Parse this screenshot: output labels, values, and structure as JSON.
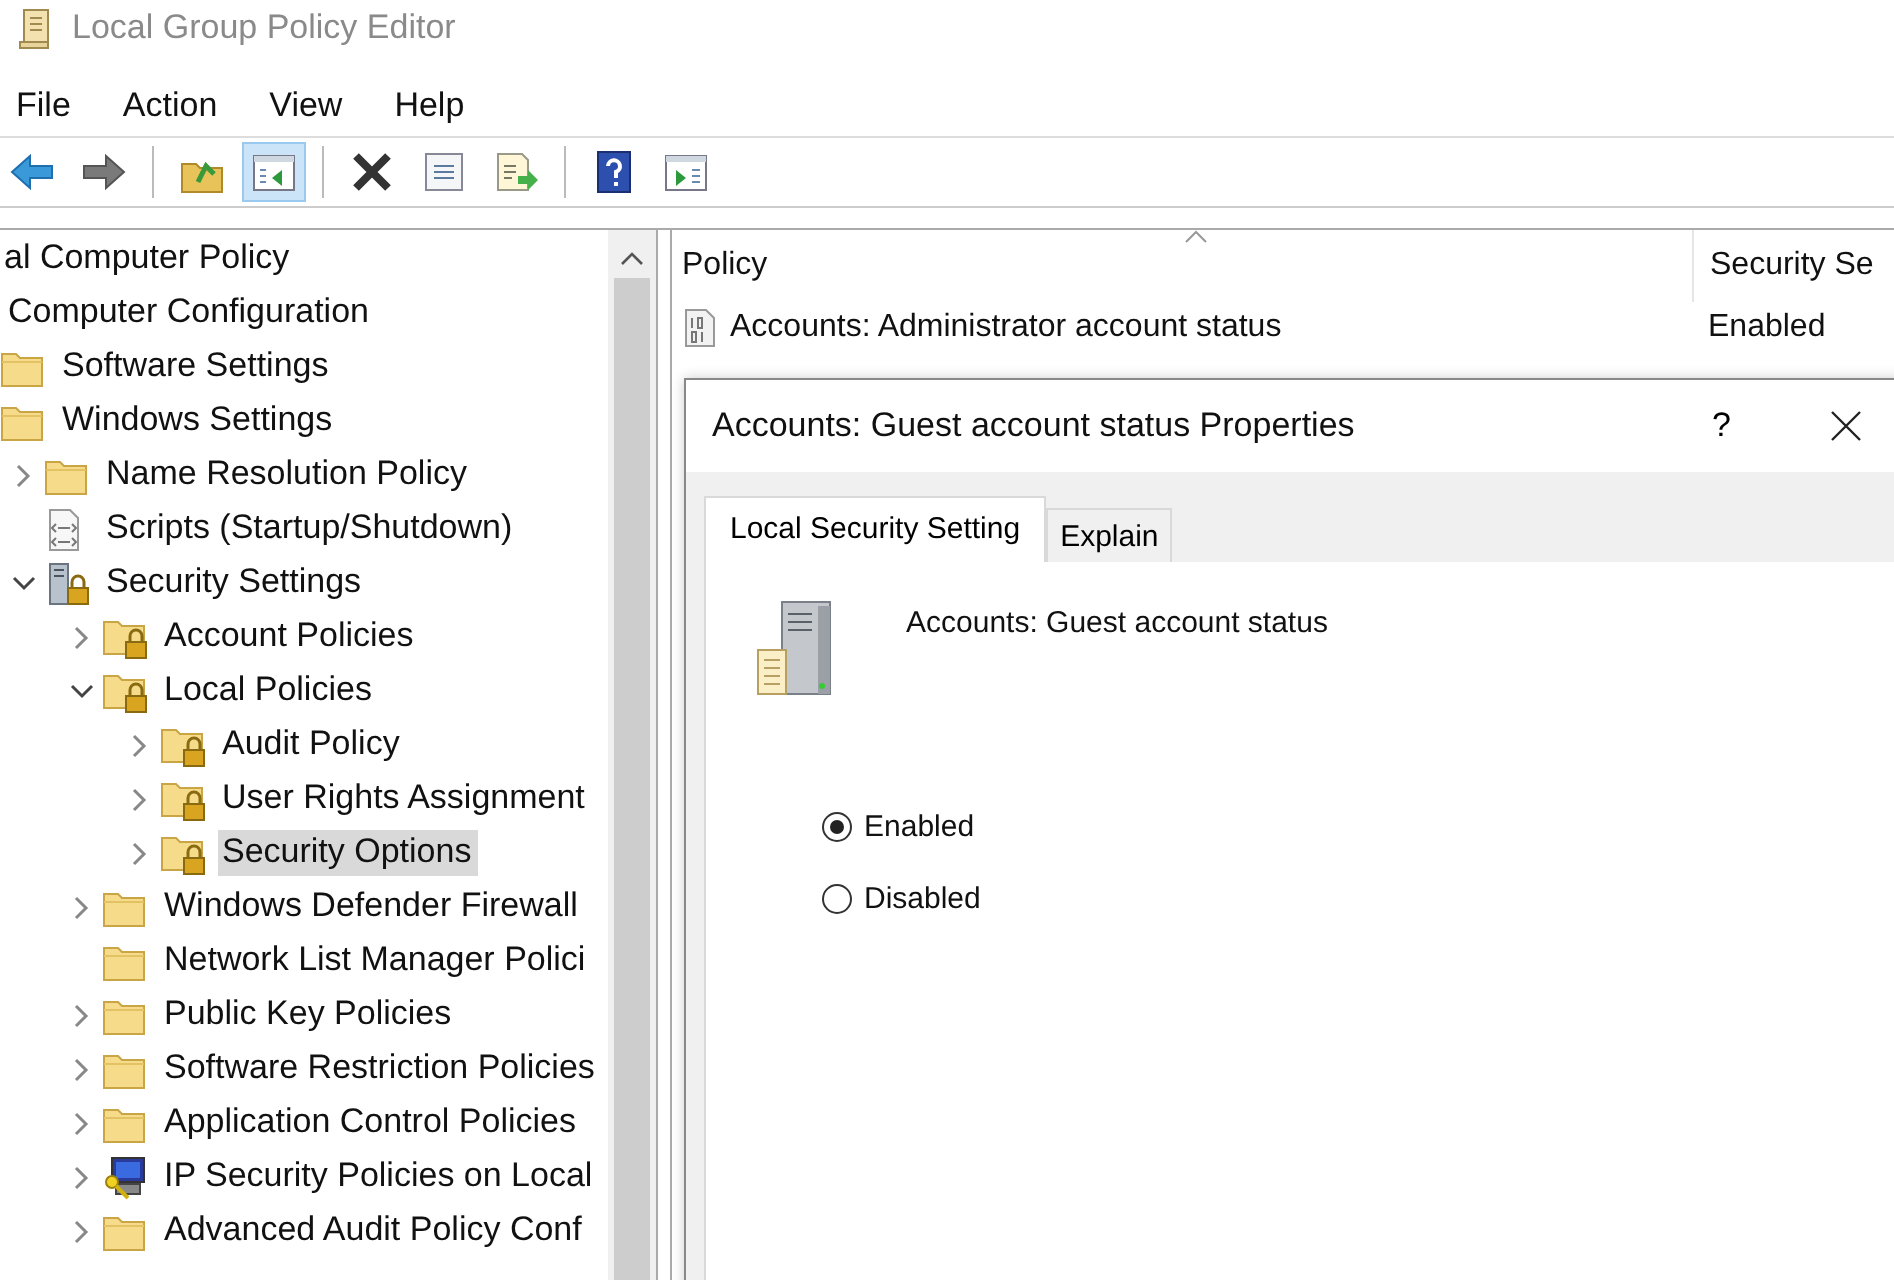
{
  "window": {
    "title": "Local Group Policy Editor"
  },
  "menu": [
    "File",
    "Action",
    "View",
    "Help"
  ],
  "toolbar": [
    [
      {
        "kind": "back",
        "pressed": false
      },
      {
        "kind": "forward",
        "pressed": false
      }
    ],
    [
      {
        "kind": "up",
        "pressed": false
      },
      {
        "kind": "tree",
        "pressed": true
      }
    ],
    [
      {
        "kind": "delete",
        "pressed": false
      },
      {
        "kind": "properties",
        "pressed": false
      },
      {
        "kind": "export",
        "pressed": false
      }
    ],
    [
      {
        "kind": "help",
        "pressed": false
      },
      {
        "kind": "panel",
        "pressed": false
      }
    ]
  ],
  "tree": {
    "items": [
      {
        "label": "al Computer Policy",
        "selected": false,
        "children": [
          {
            "label": "Computer Configuration",
            "selected": false,
            "children": [
              {
                "label": "Software Settings",
                "kind": "folder",
                "selected": false
              },
              {
                "label": "Windows Settings",
                "kind": "folder",
                "selected": false,
                "children": [
                  {
                    "label": "Name Resolution Policy",
                    "kind": "folder",
                    "expanded": false,
                    "selected": false
                  },
                  {
                    "label": "Scripts (Startup/Shutdown)",
                    "kind": "scripts",
                    "selected": false
                  },
                  {
                    "label": "Security Settings",
                    "kind": "security",
                    "expanded": true,
                    "selected": false,
                    "children": [
                      {
                        "label": "Account Policies",
                        "kind": "lock-folder",
                        "expanded": false,
                        "selected": false
                      },
                      {
                        "label": "Local Policies",
                        "kind": "lock-folder",
                        "expanded": true,
                        "selected": false,
                        "children": [
                          {
                            "label": "Audit Policy",
                            "kind": "lock-folder",
                            "expanded": false,
                            "selected": false
                          },
                          {
                            "label": "User Rights Assignment",
                            "kind": "lock-folder",
                            "expanded": false,
                            "selected": false
                          },
                          {
                            "label": "Security Options",
                            "kind": "lock-folder",
                            "expanded": false,
                            "selected": true
                          }
                        ]
                      },
                      {
                        "label": "Windows Defender Firewall",
                        "kind": "folder",
                        "expanded": false,
                        "selected": false
                      },
                      {
                        "label": "Network List Manager Polici",
                        "kind": "folder",
                        "selected": false
                      },
                      {
                        "label": "Public Key Policies",
                        "kind": "folder",
                        "expanded": false,
                        "selected": false
                      },
                      {
                        "label": "Software Restriction Policies",
                        "kind": "folder",
                        "expanded": false,
                        "selected": false
                      },
                      {
                        "label": "Application Control Policies",
                        "kind": "folder",
                        "expanded": false,
                        "selected": false
                      },
                      {
                        "label": "IP Security Policies on Local",
                        "kind": "ip-security",
                        "expanded": false,
                        "selected": false
                      },
                      {
                        "label": "Advanced Audit Policy Conf",
                        "kind": "folder",
                        "expanded": false,
                        "selected": false
                      }
                    ]
                  }
                ]
              }
            ]
          }
        ]
      }
    ]
  },
  "list": {
    "columns": [
      "Policy",
      "Security Se"
    ],
    "rows": [
      {
        "policy": "Accounts: Administrator account status",
        "setting": "Enabled"
      }
    ]
  },
  "dialog": {
    "title": "Accounts: Guest account status Properties",
    "help": "?",
    "tabs": [
      {
        "label": "Local Security Setting",
        "selected": true
      },
      {
        "label": "Explain",
        "selected": false
      }
    ],
    "heading": "Accounts: Guest account status",
    "options": [
      {
        "label": "Enabled",
        "selected": true
      },
      {
        "label": "Disabled",
        "selected": false
      }
    ]
  }
}
